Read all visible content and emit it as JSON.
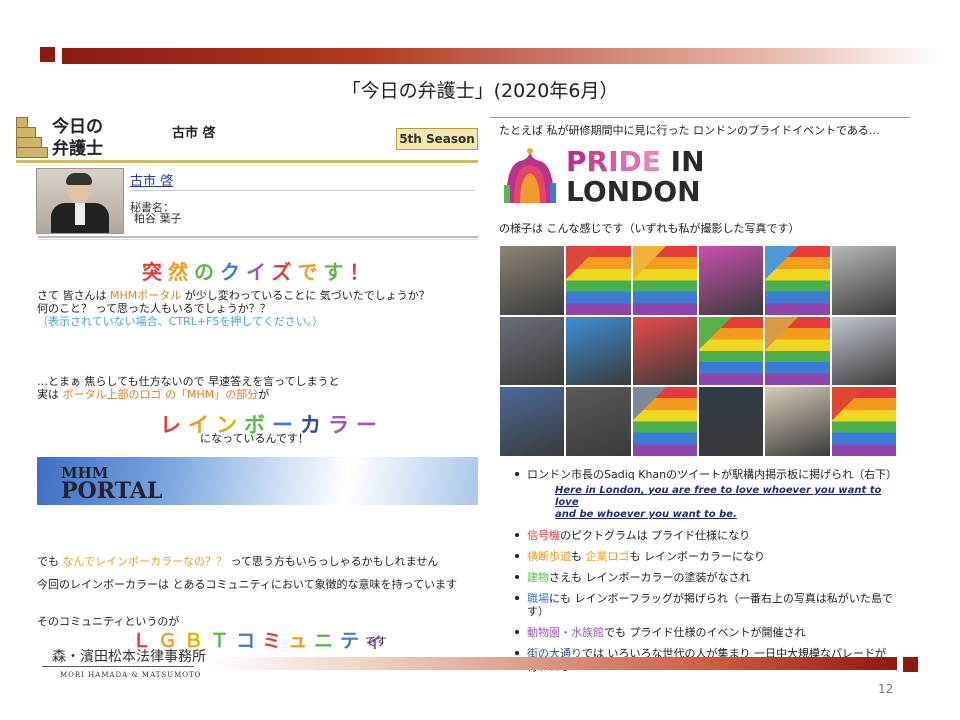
{
  "slide": {
    "title": "「今日の弁護士」(2020年6月）",
    "page_number": "12"
  },
  "left": {
    "logo_text": "今日の弁護士",
    "header_name": "古市  啓",
    "season_badge": "5th Season",
    "profile_name": "古市  啓",
    "secretary_label": "秘書名：",
    "secretary_name": "粕谷 葉子",
    "quiz_title": "突然のクイズです！",
    "quiz_colors": [
      "#e83a3a",
      "#f39b1c",
      "#5ab94a",
      "#3a7bd5",
      "#9b59b6",
      "#e83a3a",
      "#f39b1c",
      "#5ab94a"
    ],
    "intro_line1_pre": "さて  皆さんは ",
    "intro_line1_link": "MHMポータル",
    "intro_line1_post": " が少し変わっていることに 気づいたでしょうか？",
    "intro_line2": "何のこと？  って思った人もいるでしょうか？？",
    "intro_line3": "（表示されていない場合、CTRL+F5を押してください。）",
    "answer_line1": "…とまぁ  焦らしても仕方ないので  早速答えを言ってしまうと",
    "answer_line2_pre": "実は  ",
    "answer_line2_highlight": "ポータル上部のロゴ の「MHM」の部分",
    "answer_line2_post": "が",
    "rainbow_text": "レインボーカラー",
    "rainbow_colors": [
      "#e83a3a",
      "#f39b1c",
      "#d4b800",
      "#5ab94a",
      "#3a7bd5",
      "#2a4fa0",
      "#9b59b6",
      "#9b59b6"
    ],
    "rainbow_after": "になっているんです！",
    "portal_mhm": "MHM",
    "portal_word": "PORTAL",
    "question_pre": "でも  ",
    "question_highlight": "なんでレインボーカラーなの？？",
    "question_post": " って思う方もいらっしゃるかもしれません",
    "meaning_line": "今回のレインボーカラーは  とあるコミュニティにおいて象徴的な意味を持っています",
    "community_line": "そのコミュニティというのが",
    "lgbt_text": "ＬＧＢＴコミュニティ",
    "lgbt_colors": [
      "#e83a3a",
      "#f39b1c",
      "#d4b800",
      "#5ab94a",
      "#3a7bd5",
      "#e83a3a",
      "#f39b1c",
      "#5ab94a",
      "#3a7bd5",
      "#9b59b6"
    ],
    "lgbt_after": "です",
    "firm_name": "森・濱田松本法律事務所",
    "firm_name_en": "MORI HAMADA & MATSUMOTO"
  },
  "right": {
    "intro": "たとえば  私が研修期間中に見に行った  ロンドンのプライドイベントである…",
    "pride_line1": "PRIDE IN",
    "pride_line2": "LONDON",
    "photos_caption": "の様子は  こんな感じです（いずれも私が撮影した写真です）",
    "photo_colors": [
      "#8c8476",
      "#d9473a",
      "#f0b23a",
      "#c94fb0",
      "#4a9bd4",
      "#b8b8b8",
      "#6a6f77",
      "#3c8fd8",
      "#e84b4b",
      "#5ab04a",
      "#d99a44",
      "#c0c7d0",
      "#4b6a9a",
      "#5a5a5a",
      "#7a8a9a",
      "#2f3b47",
      "#d7cbb8",
      "#e1462f"
    ],
    "bullets": [
      {
        "pre": "ロンドン市長のSadiq Khanのツイートが駅構内掲示板に掲げられ（右下）",
        "hl": "",
        "post": "",
        "color": "#222"
      },
      {
        "pre": "",
        "hl": "信号機",
        "post": "のピクトグラムは  プライド仕様になり",
        "color": "#e83a3a"
      },
      {
        "pre": "",
        "hl": "横断歩道",
        "post": "も  企業ロゴも  レインボーカラーになり",
        "color": "#f39b1c"
      },
      {
        "pre": "",
        "hl": "建物",
        "post": "さえも  レインボーカラーの塗装がなされ",
        "color": "#5ab94a"
      },
      {
        "pre": "",
        "hl": "職場",
        "post": "にも  レインボーフラッグが掲げられ（一番右上の写真は私がいた島です）",
        "color": "#3a7bd5"
      },
      {
        "pre": "",
        "hl": "動物園・水族館",
        "post": "でも  プライド仕様のイベントが開催され",
        "color": "#9b59b6"
      },
      {
        "pre": "",
        "hl": "街の大通り",
        "post": "では  いろいろな世代の人が集まり  一日中大規模なパレードが行われる",
        "color": "#2a4fa0"
      }
    ],
    "bullet_extra2": "企業ロゴ",
    "quote_line1": "Here in London, you are free to love whoever you want to love",
    "quote_line2": "and be whoever you want to be."
  }
}
